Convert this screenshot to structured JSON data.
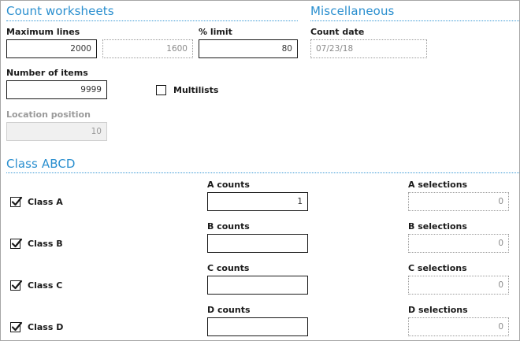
{
  "count_worksheets": {
    "title": "Count worksheets",
    "maximum_lines_label": "Maximum lines",
    "maximum_lines_value": "2000",
    "maximum_lines_secondary": "1600",
    "percent_limit_label": "% limit",
    "percent_limit_value": "80",
    "number_of_items_label": "Number of items",
    "number_of_items_value": "9999",
    "multilists_label": "Multilists",
    "multilists_checked": false,
    "location_position_label": "Location position",
    "location_position_value": "10"
  },
  "miscellaneous": {
    "title": "Miscellaneous",
    "count_date_label": "Count date",
    "count_date_value": "07/23/18"
  },
  "class_abcd": {
    "title": "Class ABCD",
    "rows": [
      {
        "class_label": "Class A",
        "checked": true,
        "counts_label": "A counts",
        "counts_value": "1",
        "selections_label": "A selections",
        "selections_value": "0"
      },
      {
        "class_label": "Class B",
        "checked": true,
        "counts_label": "B counts",
        "counts_value": "",
        "selections_label": "B selections",
        "selections_value": "0"
      },
      {
        "class_label": "Class C",
        "checked": true,
        "counts_label": "C counts",
        "counts_value": "",
        "selections_label": "C selections",
        "selections_value": "0"
      },
      {
        "class_label": "Class D",
        "checked": true,
        "counts_label": "D counts",
        "counts_value": "",
        "selections_label": "D selections",
        "selections_value": "0"
      }
    ]
  }
}
